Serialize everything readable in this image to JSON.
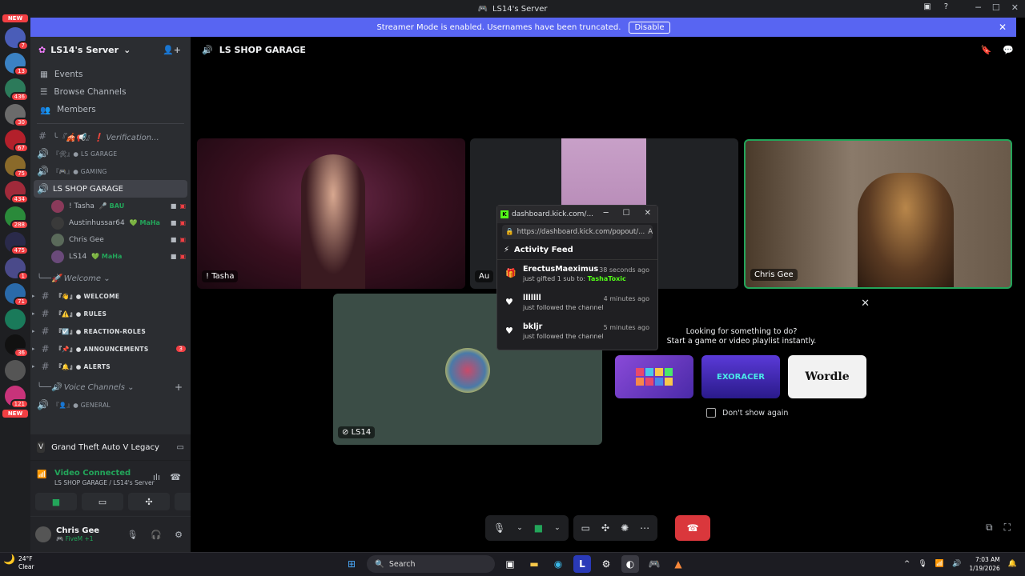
{
  "window": {
    "title": "LS14's Server"
  },
  "banner": {
    "text": "Streamer Mode is enabled. Usernames have been truncated.",
    "button": "Disable"
  },
  "guild_list": {
    "items": [
      {
        "badge": "NEW",
        "color": "#f23f43"
      },
      {
        "badge": "7",
        "color": "#4a5db8"
      },
      {
        "badge": "13",
        "color": "#3b82c4"
      },
      {
        "badge": "436",
        "color": "#2c7a5a"
      },
      {
        "badge": "30",
        "color": "#6b6b6b"
      },
      {
        "badge": "67",
        "color": "#b3202b"
      },
      {
        "badge": "75",
        "color": "#8a6a2a"
      },
      {
        "badge": "434",
        "color": "#a02a3a"
      },
      {
        "badge": "288",
        "color": "#2a8a3a"
      },
      {
        "badge": "475",
        "color": "#2a2a4a"
      },
      {
        "badge": "1",
        "color": "#4a4a8a"
      },
      {
        "badge": "71",
        "color": "#2a6aaa"
      },
      {
        "badge": "",
        "color": "#1a7a5a"
      },
      {
        "badge": "36",
        "color": "#111111"
      },
      {
        "badge": "",
        "color": "#555555"
      },
      {
        "badge": "121",
        "color": "#c8337a"
      },
      {
        "badge": "NEW",
        "color": "#f23f43"
      }
    ]
  },
  "sidebar": {
    "server_name": "LS14's Server",
    "nav": [
      {
        "label": "Events",
        "icon": "calendar-icon"
      },
      {
        "label": "Browse Channels",
        "icon": "browse-icon"
      },
      {
        "label": "Members",
        "icon": "members-icon"
      }
    ],
    "channels": [
      {
        "type": "text",
        "label": "╰『🎪📢』❗ Verification...",
        "style": "it"
      },
      {
        "type": "voice",
        "label": "『🛠』● LS GARAGE",
        "style": "caps"
      },
      {
        "type": "voice",
        "label": "『🎮』● GAMING",
        "style": "caps"
      }
    ],
    "active_channel": "LS SHOP GARAGE",
    "voice_users": [
      {
        "name": "! Tasha",
        "tag": "🎤 BAU",
        "avatar": "#8a3a5a"
      },
      {
        "name": "Austinhussar64",
        "tag": "💚 MaHa",
        "avatar": "#3a3a3a"
      },
      {
        "name": "Chris Gee",
        "tag": "",
        "avatar": "#5a6a5a"
      },
      {
        "name": "LS14",
        "tag": "💚 MaHa",
        "avatar": "#6a4a7a"
      }
    ],
    "category_welcome": "╰──🚀 Welcome ⌄",
    "text_channels": [
      {
        "label": "『👋』● WELCOME",
        "mention": ""
      },
      {
        "label": "『⚠️』● RULES",
        "mention": ""
      },
      {
        "label": "『☑️』● REACTION-ROLES",
        "mention": ""
      },
      {
        "label": "『📌』● ANNOUNCEMENTS",
        "mention": "3"
      },
      {
        "label": "『🔔』● ALERTS",
        "mention": ""
      }
    ],
    "category_voice": "╰──🔊 Voice Channels ⌄",
    "voice_general": "『👤』● GENERAL",
    "activity": "Grand Theft Auto V Legacy",
    "voice_status": "Video Connected",
    "voice_location": "LS SHOP GARAGE / LS14's Server",
    "user": {
      "name": "Chris Gee",
      "status": "🎮 FiveM +1"
    }
  },
  "main": {
    "channel_title": "LS SHOP GARAGE",
    "tiles": [
      {
        "label": "! Tasha"
      },
      {
        "label": "Au"
      },
      {
        "label": "Chris Gee"
      },
      {
        "label": "LS14"
      }
    ]
  },
  "popup": {
    "title": "dashboard.kick.com/...",
    "url": "https://dashboard.kick.com/popout/...",
    "header": "Activity Feed",
    "items": [
      {
        "name": "ErectusMaeximus",
        "time": "38 seconds ago",
        "text": "just gifted 1 sub to:",
        "target": "TashaToxic",
        "icon": "🎁"
      },
      {
        "name": "lllllll",
        "time": "4 minutes ago",
        "text": "just followed the channel",
        "target": "",
        "icon": "♥"
      },
      {
        "name": "bkljr",
        "time": "5 minutes ago",
        "text": "just followed the channel",
        "target": "",
        "icon": "♥"
      }
    ]
  },
  "activities": {
    "prompt_line1": "Looking for something to do?",
    "prompt_line2": "Start a game or video playlist instantly.",
    "games": [
      {
        "name": "",
        "color": "#7a3ac8"
      },
      {
        "name": "EXORACER",
        "color": "#3a2aa8"
      },
      {
        "name": "Wordle",
        "color": "#f2f2f2"
      }
    ],
    "checkbox_label": "Don't show again"
  },
  "taskbar": {
    "weather_temp": "24°F",
    "weather_desc": "Clear",
    "search": "Search",
    "time": "7:03 AM",
    "date": "1/19/2026"
  }
}
